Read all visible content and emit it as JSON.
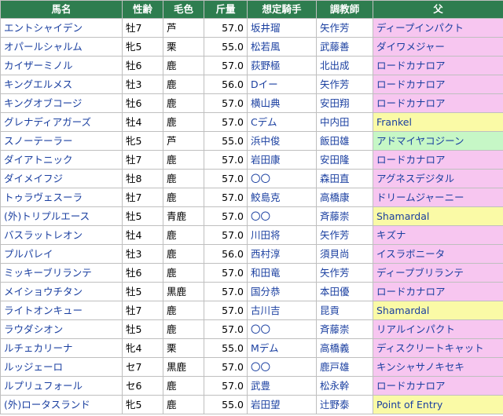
{
  "header": {
    "name": "馬名",
    "sexage": "性齢",
    "color": "毛色",
    "weight": "斤量",
    "jockey": "想定騎手",
    "trainer": "調教師",
    "sire": "父"
  },
  "colors": {
    "pink": "#f7c6f0",
    "green": "#c6f7c6",
    "yellow": "#fafaa6",
    "header": "#2e7d4f",
    "link": "#1a3fa0"
  },
  "rows": [
    {
      "name": "エントシャイデン",
      "sexage": "牡7",
      "color": "芦",
      "weight": "57.0",
      "jockey": "坂井瑠",
      "trainer": "矢作芳",
      "sire": "ディープインパクト",
      "bg": "pink"
    },
    {
      "name": "オパールシャルム",
      "sexage": "牝5",
      "color": "栗",
      "weight": "55.0",
      "jockey": "松若風",
      "trainer": "武藤善",
      "sire": "ダイワメジャー",
      "bg": "pink"
    },
    {
      "name": "カイザーミノル",
      "sexage": "牡6",
      "color": "鹿",
      "weight": "57.0",
      "jockey": "荻野極",
      "trainer": "北出成",
      "sire": "ロードカナロア",
      "bg": "pink"
    },
    {
      "name": "キングエルメス",
      "sexage": "牡3",
      "color": "鹿",
      "weight": "56.0",
      "jockey": "Dイー",
      "trainer": "矢作芳",
      "sire": "ロードカナロア",
      "bg": "pink"
    },
    {
      "name": "キングオブコージ",
      "sexage": "牡6",
      "color": "鹿",
      "weight": "57.0",
      "jockey": "横山典",
      "trainer": "安田翔",
      "sire": "ロードカナロア",
      "bg": "pink"
    },
    {
      "name": "グレナディアガーズ",
      "sexage": "牡4",
      "color": "鹿",
      "weight": "57.0",
      "jockey": "Cデム",
      "trainer": "中内田",
      "sire": "Frankel",
      "bg": "yellow"
    },
    {
      "name": "スノーテーラー",
      "sexage": "牝5",
      "color": "芦",
      "weight": "55.0",
      "jockey": "浜中俊",
      "trainer": "飯田雄",
      "sire": "アドマイヤコジーン",
      "bg": "green"
    },
    {
      "name": "ダイアトニック",
      "sexage": "牡7",
      "color": "鹿",
      "weight": "57.0",
      "jockey": "岩田康",
      "trainer": "安田隆",
      "sire": "ロードカナロア",
      "bg": "pink"
    },
    {
      "name": "ダイメイフジ",
      "sexage": "牡8",
      "color": "鹿",
      "weight": "57.0",
      "jockey": "〇〇",
      "trainer": "森田直",
      "sire": "アグネスデジタル",
      "bg": "pink"
    },
    {
      "name": "トゥラヴェスーラ",
      "sexage": "牡7",
      "color": "鹿",
      "weight": "57.0",
      "jockey": "鮫島克",
      "trainer": "高橋康",
      "sire": "ドリームジャーニー",
      "bg": "pink"
    },
    {
      "name": "(外)トリプルエース",
      "sexage": "牡5",
      "color": "青鹿",
      "weight": "57.0",
      "jockey": "〇〇",
      "trainer": "斉藤崇",
      "sire": "Shamardal",
      "bg": "yellow"
    },
    {
      "name": "バスラットレオン",
      "sexage": "牡4",
      "color": "鹿",
      "weight": "57.0",
      "jockey": "川田将",
      "trainer": "矢作芳",
      "sire": "キズナ",
      "bg": "pink"
    },
    {
      "name": "プルパレイ",
      "sexage": "牡3",
      "color": "鹿",
      "weight": "56.0",
      "jockey": "西村淳",
      "trainer": "須貝尚",
      "sire": "イスラボニータ",
      "bg": "pink"
    },
    {
      "name": "ミッキーブリランテ",
      "sexage": "牡6",
      "color": "鹿",
      "weight": "57.0",
      "jockey": "和田竜",
      "trainer": "矢作芳",
      "sire": "ディープブリランテ",
      "bg": "pink"
    },
    {
      "name": "メイショウチタン",
      "sexage": "牡5",
      "color": "黒鹿",
      "weight": "57.0",
      "jockey": "国分恭",
      "trainer": "本田優",
      "sire": "ロードカナロア",
      "bg": "pink"
    },
    {
      "name": "ライトオンキュー",
      "sexage": "牡7",
      "color": "鹿",
      "weight": "57.0",
      "jockey": "古川吉",
      "trainer": "昆貢",
      "sire": "Shamardal",
      "bg": "yellow"
    },
    {
      "name": "ラウダシオン",
      "sexage": "牡5",
      "color": "鹿",
      "weight": "57.0",
      "jockey": "〇〇",
      "trainer": "斉藤崇",
      "sire": "リアルインパクト",
      "bg": "pink"
    },
    {
      "name": "ルチェカリーナ",
      "sexage": "牝4",
      "color": "栗",
      "weight": "55.0",
      "jockey": "Mデム",
      "trainer": "高橋義",
      "sire": "ディスクリートキャット",
      "bg": "pink"
    },
    {
      "name": "ルッジェーロ",
      "sexage": "セ7",
      "color": "黒鹿",
      "weight": "57.0",
      "jockey": "〇〇",
      "trainer": "鹿戸雄",
      "sire": "キンシャサノキセキ",
      "bg": "pink"
    },
    {
      "name": "ルプリュフォール",
      "sexage": "セ6",
      "color": "鹿",
      "weight": "57.0",
      "jockey": "武豊",
      "trainer": "松永幹",
      "sire": "ロードカナロア",
      "bg": "pink"
    },
    {
      "name": "(外)ロータスランド",
      "sexage": "牝5",
      "color": "鹿",
      "weight": "55.0",
      "jockey": "岩田望",
      "trainer": "辻野泰",
      "sire": "Point of Entry",
      "bg": "yellow"
    }
  ]
}
